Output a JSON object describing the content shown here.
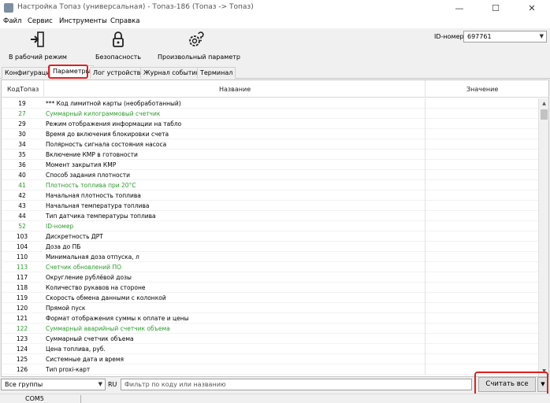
{
  "window": {
    "title": "Настройка Топаз (универсальная) - Топаз-186 (Топаз -> Топаз)",
    "minimize": "—",
    "maximize": "☐",
    "close": "✕"
  },
  "menu": [
    "Файл",
    "Сервис",
    "Инструменты",
    "Справка"
  ],
  "toolbar": {
    "work_mode": "В рабочий режим",
    "security": "Безопасность",
    "arbitrary_param": "Произвольный параметр",
    "id_label": "ID-номер",
    "id_value": "697761"
  },
  "tabs": [
    "Конфигурация",
    "Параметры",
    "Лог устройства",
    "Журнал событий",
    "Терминал"
  ],
  "active_tab": "Параметры",
  "grid": {
    "headers": {
      "code": "КодТопаз",
      "name": "Название",
      "value": "Значение"
    },
    "rows": [
      {
        "code": "19",
        "name": "*** Код лимитной карты (необработанный)",
        "green": false
      },
      {
        "code": "27",
        "name": "Суммарный килограммовый счетчик",
        "green": true
      },
      {
        "code": "29",
        "name": "Режим отображения информации на табло",
        "green": false
      },
      {
        "code": "30",
        "name": "Время до включения блокировки счета",
        "green": false
      },
      {
        "code": "34",
        "name": "Полярность сигнала состояния насоса",
        "green": false
      },
      {
        "code": "35",
        "name": "Включение КМР в готовности",
        "green": false
      },
      {
        "code": "36",
        "name": "Момент закрытия КМР",
        "green": false
      },
      {
        "code": "40",
        "name": "Способ задания плотности",
        "green": false
      },
      {
        "code": "41",
        "name": "Плотность топлива при 20°C",
        "green": true
      },
      {
        "code": "42",
        "name": "Начальная плотность топлива",
        "green": false
      },
      {
        "code": "43",
        "name": "Начальная температура топлива",
        "green": false
      },
      {
        "code": "44",
        "name": "Тип датчика температуры топлива",
        "green": false
      },
      {
        "code": "52",
        "name": "ID-номер",
        "green": true
      },
      {
        "code": "103",
        "name": "Дискретность ДРТ",
        "green": false
      },
      {
        "code": "104",
        "name": "Доза до ПБ",
        "green": false
      },
      {
        "code": "110",
        "name": "Минимальная доза отпуска, л",
        "green": false
      },
      {
        "code": "113",
        "name": "Счетчик обновлений ПО",
        "green": true
      },
      {
        "code": "117",
        "name": "Округление рублёвой дозы",
        "green": false
      },
      {
        "code": "118",
        "name": "Количество рукавов на стороне",
        "green": false
      },
      {
        "code": "119",
        "name": "Скорость обмена данными с колонкой",
        "green": false
      },
      {
        "code": "120",
        "name": "Прямой пуск",
        "green": false
      },
      {
        "code": "121",
        "name": "Формат отображения суммы к оплате и цены",
        "green": false
      },
      {
        "code": "122",
        "name": "Суммарный аварийный счетчик объема",
        "green": true
      },
      {
        "code": "123",
        "name": "Суммарный счетчик объема",
        "green": false
      },
      {
        "code": "124",
        "name": "Цена топлива, руб.",
        "green": false
      },
      {
        "code": "125",
        "name": "Системные дата и время",
        "green": false
      },
      {
        "code": "126",
        "name": "Тип proxi-карт",
        "green": false
      }
    ]
  },
  "bottom": {
    "group": "Все группы",
    "lang": "RU",
    "filter_placeholder": "Фильтр по коду или названию",
    "read_all": "Считать все"
  },
  "status": {
    "port": "COM5"
  },
  "colors": {
    "green_row": "#2c9b2c",
    "highlight": "#e02020"
  }
}
